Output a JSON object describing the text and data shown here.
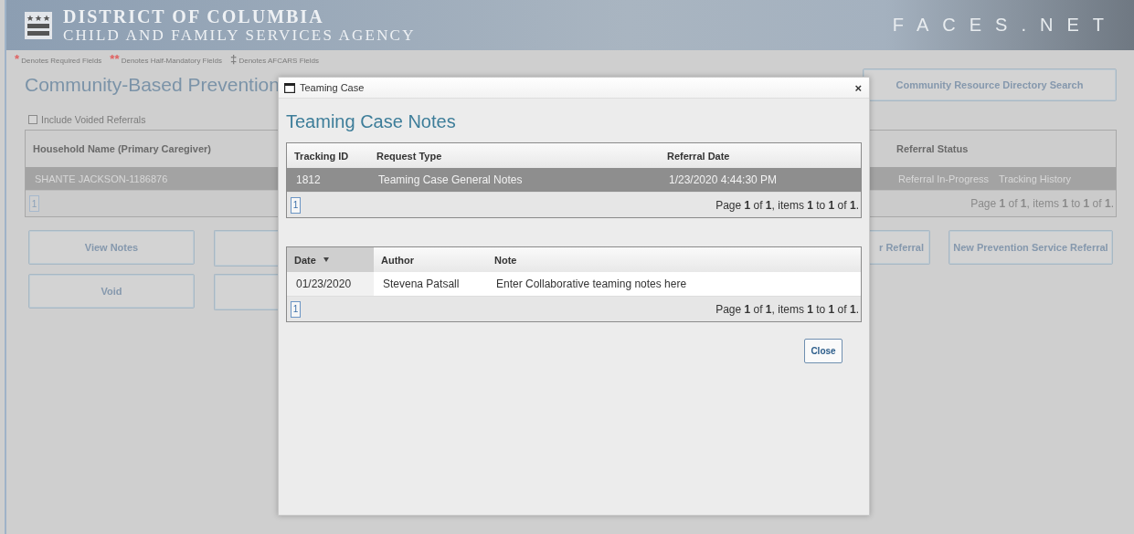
{
  "header": {
    "agency_line_1": "DISTRICT OF COLUMBIA",
    "agency_line_2": "CHILD AND FAMILY SERVICES AGENCY",
    "product": "FACES.NET"
  },
  "legend": [
    {
      "mark": "*",
      "text": "Denotes Required Fields",
      "color": "#e06060"
    },
    {
      "mark": "**",
      "text": "Denotes Half-Mandatory Fields",
      "color": "#e06060"
    },
    {
      "mark": "‡",
      "text": "Denotes AFCARS Fields",
      "color": "#808080"
    }
  ],
  "page": {
    "title": "Community-Based Prevention",
    "directory_button": "Community Resource Directory Search",
    "include_voided": {
      "label": "Include Voided Referrals",
      "checked": false
    },
    "table": {
      "columns": [
        {
          "label": "Household Name (Primary Caregiver)"
        },
        {
          "label": "Referral Status"
        }
      ],
      "rows": [
        {
          "cells": [
            "SHANTE JACKSON-1186876",
            "Referral In-Progress",
            "Tracking History"
          ],
          "selected": true
        }
      ],
      "pager": {
        "page": "1",
        "summary": "Page **1** of **1**, items **1** to **1** of **1**."
      }
    },
    "left_buttons": [
      "View Notes",
      "Void"
    ],
    "right_buttons": [
      "r Referral",
      "New Prevention Service Referral"
    ]
  },
  "modal": {
    "title": "Teaming Case",
    "close": "×",
    "heading": "Teaming Case Notes",
    "requests": {
      "columns": [
        {
          "label": "Tracking ID"
        },
        {
          "label": "Request Type"
        },
        {
          "label": "Referral Date"
        }
      ],
      "rows": [
        {
          "cells": [
            "1812",
            "Teaming Case General Notes",
            "1/23/2020 4:44:30 PM"
          ],
          "selected": true
        }
      ],
      "pager": {
        "page": "1",
        "summary": "Page **1** of **1**, items **1** to **1** of **1**."
      }
    },
    "notes": {
      "columns": [
        {
          "label": "Date",
          "sorted": true
        },
        {
          "label": "Author",
          "sorted": false
        },
        {
          "label": "Note",
          "sorted": false
        }
      ],
      "rows": [
        {
          "cells": [
            "01/23/2020",
            "Stevena Patsall",
            "Enter Collaborative teaming notes here"
          ],
          "selected": false
        }
      ],
      "pager": {
        "page": "1",
        "summary": "Page **1** of **1**, items **1** to **1** of **1**."
      }
    },
    "close_button": "Close"
  }
}
